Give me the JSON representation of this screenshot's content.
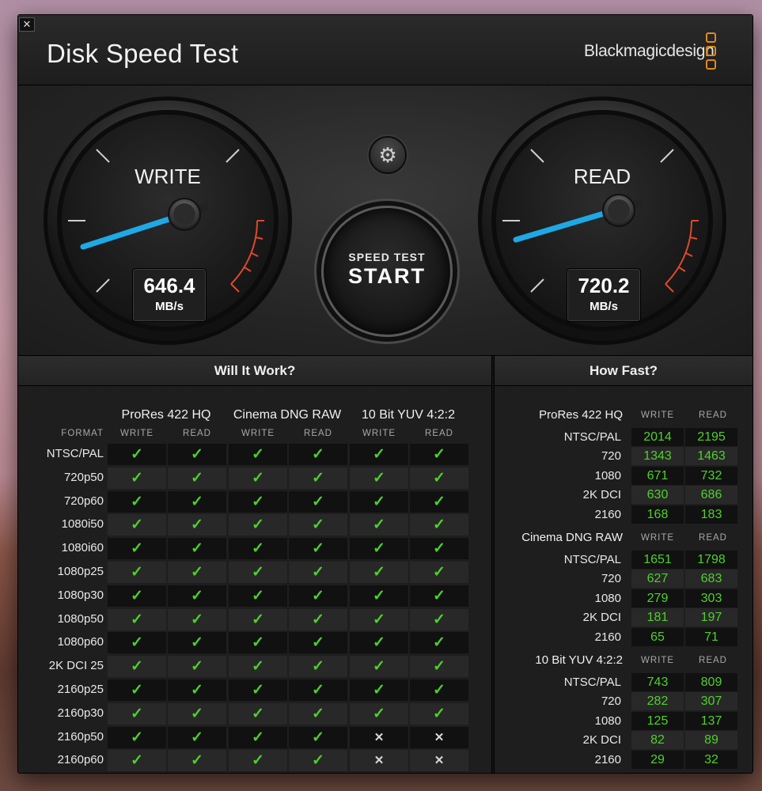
{
  "window": {
    "title": "Disk Speed Test",
    "brand": "Blackmagicdesign",
    "close_glyph": "✕"
  },
  "colors": {
    "accent_blue": "#1ea9e6",
    "check_green": "#4dd12a",
    "danger_red": "#e0482a",
    "logo_orange": "#e08a1e"
  },
  "gauges": {
    "write": {
      "label": "WRITE",
      "value": "646.4",
      "unit": "MB/s"
    },
    "read": {
      "label": "READ",
      "value": "720.2",
      "unit": "MB/s"
    }
  },
  "controls": {
    "settings_icon": "gear-icon",
    "start_small": "SPEED TEST",
    "start_big": "START"
  },
  "will_it_work": {
    "title": "Will It Work?",
    "format_header": "FORMAT",
    "write_header": "WRITE",
    "read_header": "READ",
    "groups": [
      "ProRes 422 HQ",
      "Cinema DNG RAW",
      "10 Bit YUV 4:2:2"
    ],
    "rows": [
      {
        "format": "NTSC/PAL",
        "results": [
          1,
          1,
          1,
          1,
          1,
          1
        ]
      },
      {
        "format": "720p50",
        "results": [
          1,
          1,
          1,
          1,
          1,
          1
        ]
      },
      {
        "format": "720p60",
        "results": [
          1,
          1,
          1,
          1,
          1,
          1
        ]
      },
      {
        "format": "1080i50",
        "results": [
          1,
          1,
          1,
          1,
          1,
          1
        ]
      },
      {
        "format": "1080i60",
        "results": [
          1,
          1,
          1,
          1,
          1,
          1
        ]
      },
      {
        "format": "1080p25",
        "results": [
          1,
          1,
          1,
          1,
          1,
          1
        ]
      },
      {
        "format": "1080p30",
        "results": [
          1,
          1,
          1,
          1,
          1,
          1
        ]
      },
      {
        "format": "1080p50",
        "results": [
          1,
          1,
          1,
          1,
          1,
          1
        ]
      },
      {
        "format": "1080p60",
        "results": [
          1,
          1,
          1,
          1,
          1,
          1
        ]
      },
      {
        "format": "2K DCI 25",
        "results": [
          1,
          1,
          1,
          1,
          1,
          1
        ]
      },
      {
        "format": "2160p25",
        "results": [
          1,
          1,
          1,
          1,
          1,
          1
        ]
      },
      {
        "format": "2160p30",
        "results": [
          1,
          1,
          1,
          1,
          1,
          1
        ]
      },
      {
        "format": "2160p50",
        "results": [
          1,
          1,
          1,
          1,
          0,
          0
        ]
      },
      {
        "format": "2160p60",
        "results": [
          1,
          1,
          1,
          1,
          0,
          0
        ]
      }
    ],
    "check_glyph": "✓",
    "cross_glyph": "✕"
  },
  "how_fast": {
    "title": "How Fast?",
    "write_header": "WRITE",
    "read_header": "READ",
    "groups": [
      {
        "name": "ProRes 422 HQ",
        "rows": [
          {
            "format": "NTSC/PAL",
            "write": "2014",
            "read": "2195"
          },
          {
            "format": "720",
            "write": "1343",
            "read": "1463"
          },
          {
            "format": "1080",
            "write": "671",
            "read": "732"
          },
          {
            "format": "2K DCI",
            "write": "630",
            "read": "686"
          },
          {
            "format": "2160",
            "write": "168",
            "read": "183"
          }
        ]
      },
      {
        "name": "Cinema DNG RAW",
        "rows": [
          {
            "format": "NTSC/PAL",
            "write": "1651",
            "read": "1798"
          },
          {
            "format": "720",
            "write": "627",
            "read": "683"
          },
          {
            "format": "1080",
            "write": "279",
            "read": "303"
          },
          {
            "format": "2K DCI",
            "write": "181",
            "read": "197"
          },
          {
            "format": "2160",
            "write": "65",
            "read": "71"
          }
        ]
      },
      {
        "name": "10 Bit YUV 4:2:2",
        "rows": [
          {
            "format": "NTSC/PAL",
            "write": "743",
            "read": "809"
          },
          {
            "format": "720",
            "write": "282",
            "read": "307"
          },
          {
            "format": "1080",
            "write": "125",
            "read": "137"
          },
          {
            "format": "2K DCI",
            "write": "82",
            "read": "89"
          },
          {
            "format": "2160",
            "write": "29",
            "read": "32"
          }
        ]
      }
    ]
  }
}
